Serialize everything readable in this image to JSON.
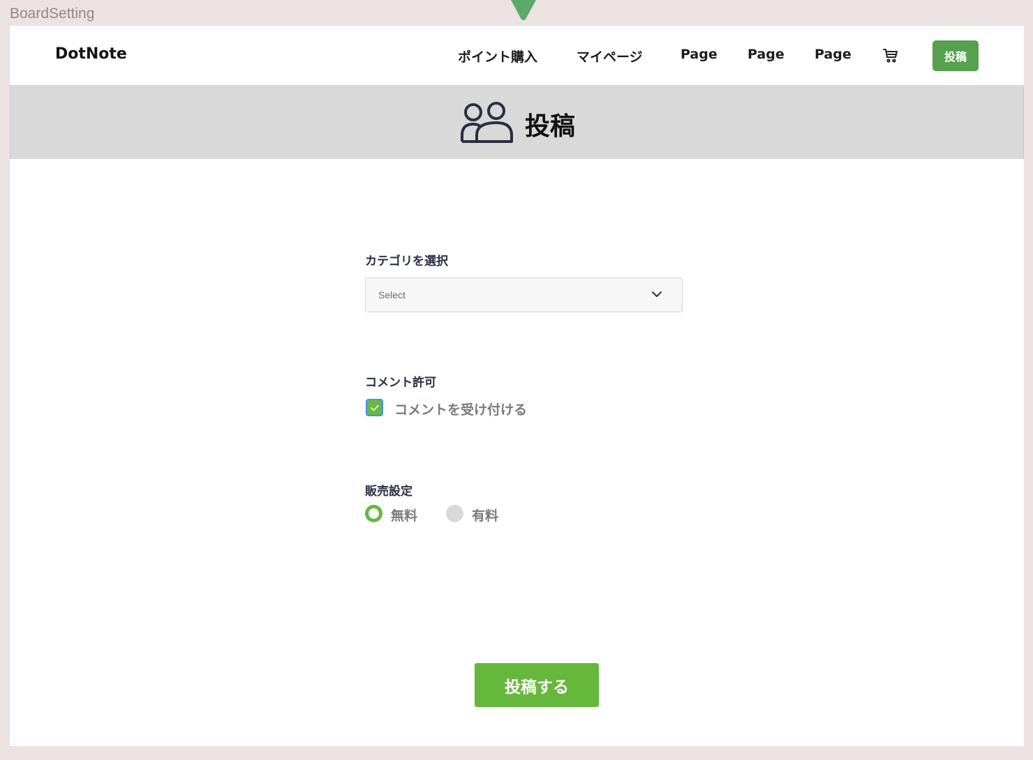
{
  "frame": {
    "label": "BoardSetting",
    "marker_color": "#5aaa6a"
  },
  "navbar": {
    "brand": "DotNote",
    "links": [
      "ポイント購入",
      "マイページ",
      "Page",
      "Page",
      "Page"
    ],
    "cart_icon": "cart-icon",
    "post_button": "投稿",
    "post_button_color": "#55a14e"
  },
  "title_band": {
    "icon": "users-icon",
    "title": "投稿",
    "background": "#d9d9d9"
  },
  "form": {
    "category": {
      "label": "カテゴリを選択",
      "placeholder": "Select",
      "icon": "chevron-down-icon"
    },
    "comment": {
      "label": "コメント許可",
      "checkbox_label": "コメントを受け付ける",
      "checked": true
    },
    "sales": {
      "label": "販売設定",
      "options": [
        "無料",
        "有料"
      ],
      "selected": "無料"
    },
    "submit": "投稿する",
    "accent_color": "#66b83d"
  }
}
